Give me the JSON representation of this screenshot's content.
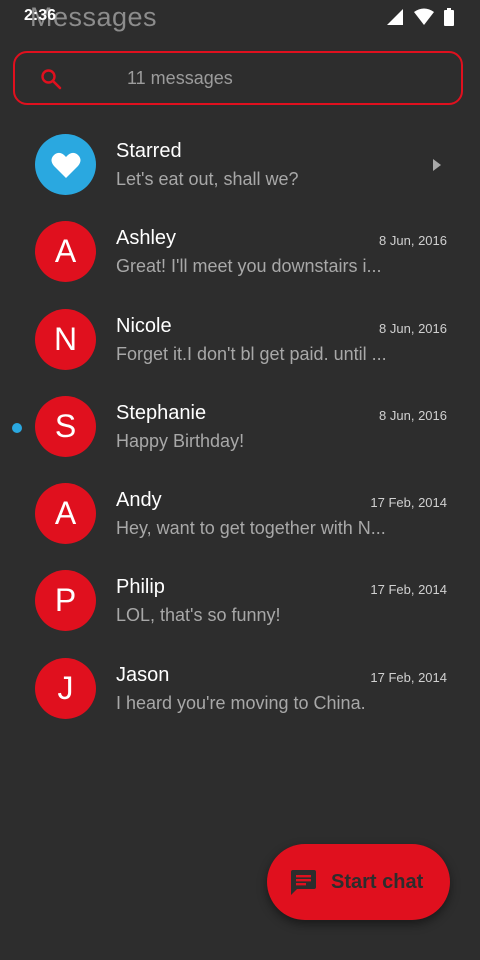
{
  "status_bar": {
    "time": "2:36"
  },
  "app": {
    "title": "Messages"
  },
  "search": {
    "label": "11 messages",
    "icon": "search-icon"
  },
  "colors": {
    "accent": "#e0101e",
    "starred": "#2aa8e0",
    "background": "#2d2d2d"
  },
  "conversations": [
    {
      "initial": "",
      "name": "Starred",
      "snippet": "Let's eat out, shall we?",
      "date": "",
      "icon": "heart-icon"
    },
    {
      "initial": "A",
      "name": "Ashley",
      "snippet": "Great! I'll meet you downstairs i...",
      "date": "8 Jun, 2016"
    },
    {
      "initial": "N",
      "name": "Nicole",
      "snippet": "Forget it.I don't bl get paid. until ...",
      "date": "8 Jun, 2016"
    },
    {
      "initial": "S",
      "name": "Stephanie",
      "snippet": "Happy Birthday!",
      "date": "8 Jun, 2016",
      "unread": true
    },
    {
      "initial": "A",
      "name": "Andy",
      "snippet": "Hey, want to get together with N...",
      "date": "17 Feb, 2014"
    },
    {
      "initial": "P",
      "name": "Philip",
      "snippet": "LOL, that's so funny!",
      "date": "17 Feb, 2014"
    },
    {
      "initial": "J",
      "name": "Jason",
      "snippet": "I heard you're moving to China.",
      "date": "17 Feb, 2014"
    }
  ],
  "fab": {
    "label": "Start chat",
    "icon": "chat-icon"
  }
}
